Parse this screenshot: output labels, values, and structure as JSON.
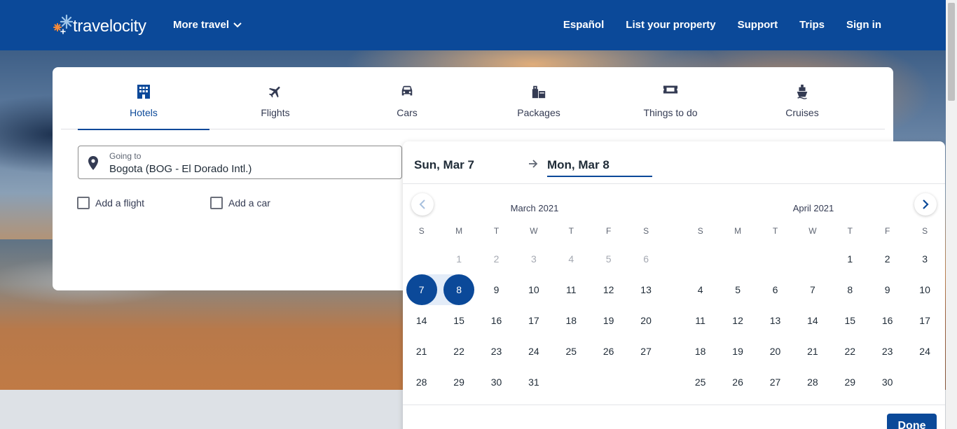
{
  "header": {
    "logo_text": "travelocity",
    "more_travel_label": "More travel",
    "nav": [
      "Español",
      "List your property",
      "Support",
      "Trips",
      "Sign in"
    ]
  },
  "tabs": [
    {
      "label": "Hotels",
      "icon": "hotel-icon",
      "active": true
    },
    {
      "label": "Flights",
      "icon": "plane-icon",
      "active": false
    },
    {
      "label": "Cars",
      "icon": "car-icon",
      "active": false
    },
    {
      "label": "Packages",
      "icon": "packages-icon",
      "active": false
    },
    {
      "label": "Things to do",
      "icon": "ticket-icon",
      "active": false
    },
    {
      "label": "Cruises",
      "icon": "cruise-icon",
      "active": false
    }
  ],
  "search": {
    "going_to_label": "Going to",
    "going_to_value": "Bogota (BOG - El Dorado Intl.)",
    "add_flight_label": "Add a flight",
    "add_car_label": "Add a car"
  },
  "datepicker": {
    "start_date": "Sun, Mar 7",
    "end_date": "Mon, Mar 8",
    "weekday_headers": [
      "S",
      "M",
      "T",
      "W",
      "T",
      "F",
      "S"
    ],
    "months": [
      {
        "title": "March 2021",
        "weeks": [
          [
            "",
            "1",
            "2",
            "3",
            "4",
            "5",
            "6"
          ],
          [
            "7",
            "8",
            "9",
            "10",
            "11",
            "12",
            "13"
          ],
          [
            "14",
            "15",
            "16",
            "17",
            "18",
            "19",
            "20"
          ],
          [
            "21",
            "22",
            "23",
            "24",
            "25",
            "26",
            "27"
          ],
          [
            "28",
            "29",
            "30",
            "31",
            "",
            "",
            ""
          ]
        ],
        "disabled_days": [
          "1",
          "2",
          "3",
          "4",
          "5",
          "6"
        ],
        "selected_days": [
          "7",
          "8"
        ]
      },
      {
        "title": "April 2021",
        "weeks": [
          [
            "",
            "",
            "",
            "",
            "1",
            "2",
            "3"
          ],
          [
            "4",
            "5",
            "6",
            "7",
            "8",
            "9",
            "10"
          ],
          [
            "11",
            "12",
            "13",
            "14",
            "15",
            "16",
            "17"
          ],
          [
            "18",
            "19",
            "20",
            "21",
            "22",
            "23",
            "24"
          ],
          [
            "25",
            "26",
            "27",
            "28",
            "29",
            "30",
            ""
          ]
        ],
        "disabled_days": [],
        "selected_days": []
      }
    ],
    "done_label": "Done"
  },
  "colors": {
    "brand_blue": "#0b4999",
    "selected_day": "#0b4999"
  }
}
